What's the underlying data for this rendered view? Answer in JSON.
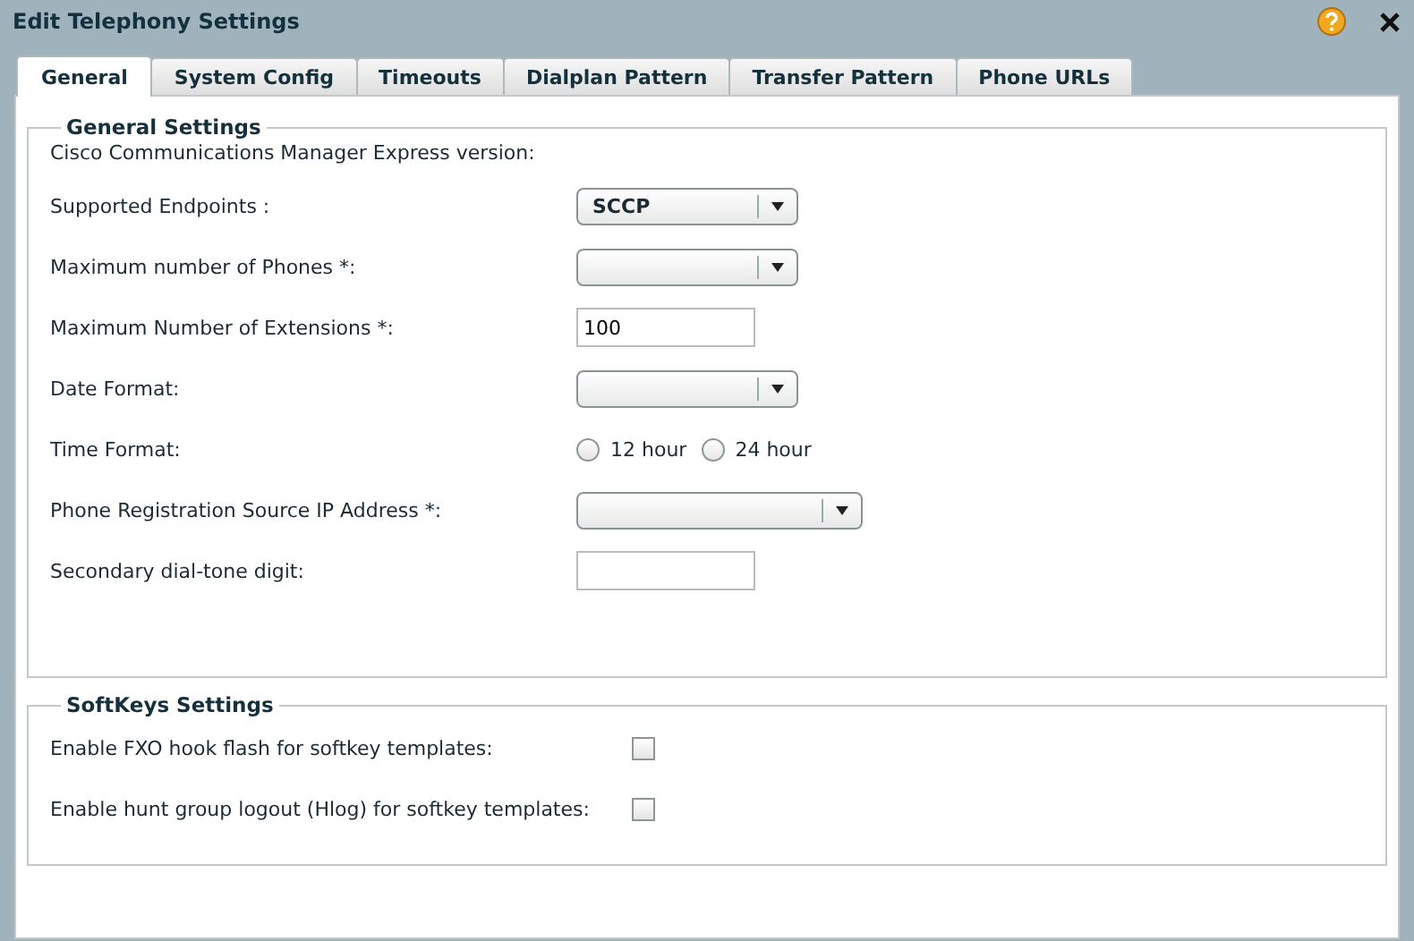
{
  "window": {
    "title": "Edit Telephony Settings"
  },
  "tabs": [
    {
      "label": "General",
      "selected": true
    },
    {
      "label": "System Config",
      "selected": false
    },
    {
      "label": "Timeouts",
      "selected": false
    },
    {
      "label": "Dialplan Pattern",
      "selected": false
    },
    {
      "label": "Transfer Pattern",
      "selected": false
    },
    {
      "label": "Phone URLs",
      "selected": false
    }
  ],
  "sections": [
    {
      "legend": "General Settings",
      "rows": [
        {
          "kind": "text",
          "label": "Cisco Communications Manager Express version:"
        },
        {
          "kind": "select",
          "label": "Supported Endpoints :",
          "value": "SCCP",
          "wide": false
        },
        {
          "kind": "select",
          "label": "Maximum number of Phones *:",
          "wide": false
        },
        {
          "kind": "input",
          "label": "Maximum Number of Extensions *:",
          "value": "100"
        },
        {
          "kind": "select",
          "label": "Date Format:",
          "wide": false
        },
        {
          "kind": "radio",
          "label": "Time Format:",
          "options": [
            {
              "label": "12 hour",
              "selected": false
            },
            {
              "label": "24 hour",
              "selected": false
            }
          ]
        },
        {
          "kind": "select",
          "label": "Phone Registration Source IP Address *:",
          "wide": true
        },
        {
          "kind": "input",
          "label": "Secondary dial-tone digit:"
        }
      ]
    },
    {
      "legend": "SoftKeys Settings",
      "rows": [
        {
          "kind": "checkbox",
          "label": "Enable FXO hook flash for softkey templates:",
          "checked": false
        },
        {
          "kind": "checkbox",
          "label": "Enable hunt group logout (Hlog) for softkey templates:",
          "checked": false
        }
      ]
    }
  ]
}
